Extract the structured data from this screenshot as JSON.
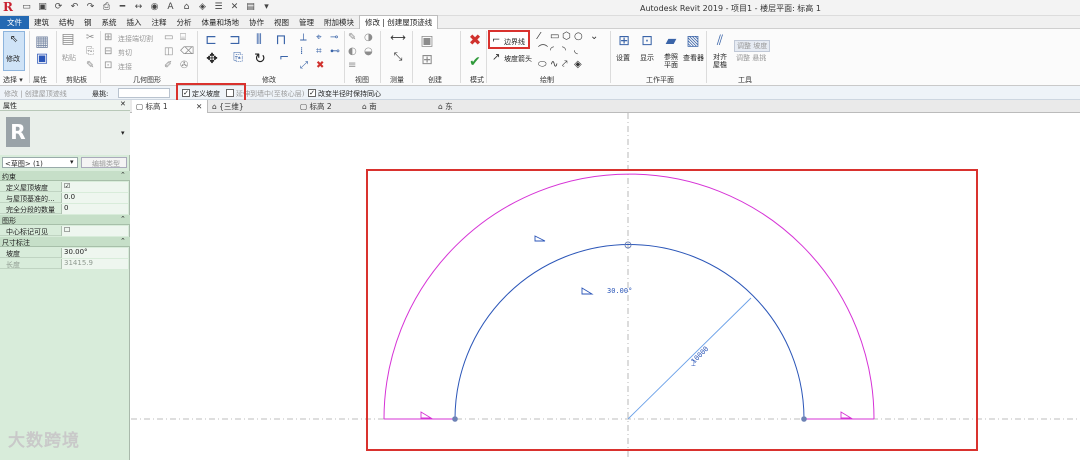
{
  "window": {
    "title": "Autodesk Revit 2019 - 项目1 - 楼层平面: 标高 1",
    "logo": "R"
  },
  "quick_access": [
    "folder-open-icon",
    "save-icon",
    "sync-icon",
    "undo-icon",
    "redo-icon",
    "print-icon",
    "measure-icon",
    "dimension-icon",
    "tag-icon",
    "text-icon",
    "view-3d-icon",
    "section-icon",
    "thin-lines-icon",
    "close-hidden-icon",
    "switch-windows-icon",
    "customize-icon"
  ],
  "menu": {
    "items": [
      "文件",
      "建筑",
      "结构",
      "钢",
      "系统",
      "插入",
      "注释",
      "分析",
      "体量和场地",
      "协作",
      "视图",
      "管理",
      "附加模块",
      "修改 | 创建屋顶迹线"
    ],
    "active_index": 13
  },
  "ribbon": {
    "panels": [
      "选择",
      "属性",
      "剪贴板",
      "几何图形",
      "修改",
      "视图",
      "测量",
      "创建",
      "模式",
      "绘制",
      "工作平面",
      "工具"
    ],
    "modify_label": "修改",
    "select_dropdown": "选择 ▾",
    "clipboard": {
      "paste": "粘贴"
    },
    "geometry": {
      "join": "连接端切割",
      "cut": "剪切",
      "join2": "连接"
    },
    "mode": {
      "finish": "✔",
      "cancel": "✖"
    },
    "draw": {
      "boundary_line": "边界线",
      "slope_arrow": "坡度箭头"
    },
    "workplane": {
      "set": "设置",
      "show": "显示",
      "ref_plane": "参照平面",
      "viewer": "查看器"
    },
    "tools": {
      "align_eaves": "对齐屋檐",
      "adjust_width": "调整 坡度",
      "adjust_offset": "调整 悬挑"
    }
  },
  "options_bar": {
    "mode_text": "修改 | 创建屋顶迹线",
    "overhang_label": "悬挑:",
    "define_slope": {
      "label": "定义坡度",
      "checked": true
    },
    "extend_to_wall": {
      "label": "延伸到墙中(至核心层)",
      "checked": false
    },
    "radius_lock": {
      "label": "改变半径时保持同心",
      "checked": true
    }
  },
  "properties": {
    "header": "属性",
    "type_selector": "<草图> (1)",
    "edit_type": "编辑类型",
    "groups": [
      {
        "name": "约束",
        "rows": [
          {
            "key": "定义屋顶坡度",
            "value": "☑",
            "dim": false
          },
          {
            "key": "与屋顶基准的...",
            "value": "0.0",
            "dim": false
          },
          {
            "key": "完全分段的数量",
            "value": "0",
            "dim": false
          }
        ]
      },
      {
        "name": "图形",
        "rows": [
          {
            "key": "中心标记可见",
            "value": "☐",
            "dim": false
          }
        ]
      },
      {
        "name": "尺寸标注",
        "rows": [
          {
            "key": "坡度",
            "value": "30.00°",
            "dim": false
          },
          {
            "key": "长度",
            "value": "31415.9",
            "dim": true
          }
        ]
      }
    ]
  },
  "view_tabs": [
    {
      "label": "标高 1",
      "active": true
    },
    {
      "label": "{三维}",
      "active": false
    },
    {
      "label": "标高 2",
      "active": false
    },
    {
      "label": "南",
      "active": false
    },
    {
      "label": "东",
      "active": false
    }
  ],
  "drawing": {
    "slope_label": "30.00°",
    "radius_dimension": "10000",
    "colors": {
      "outer_arc": "#d633d6",
      "inner_arc": "#2b56b8",
      "highlight": "#d9322e",
      "center_line": "#a9a9a9"
    }
  },
  "watermark": "大数跨境"
}
